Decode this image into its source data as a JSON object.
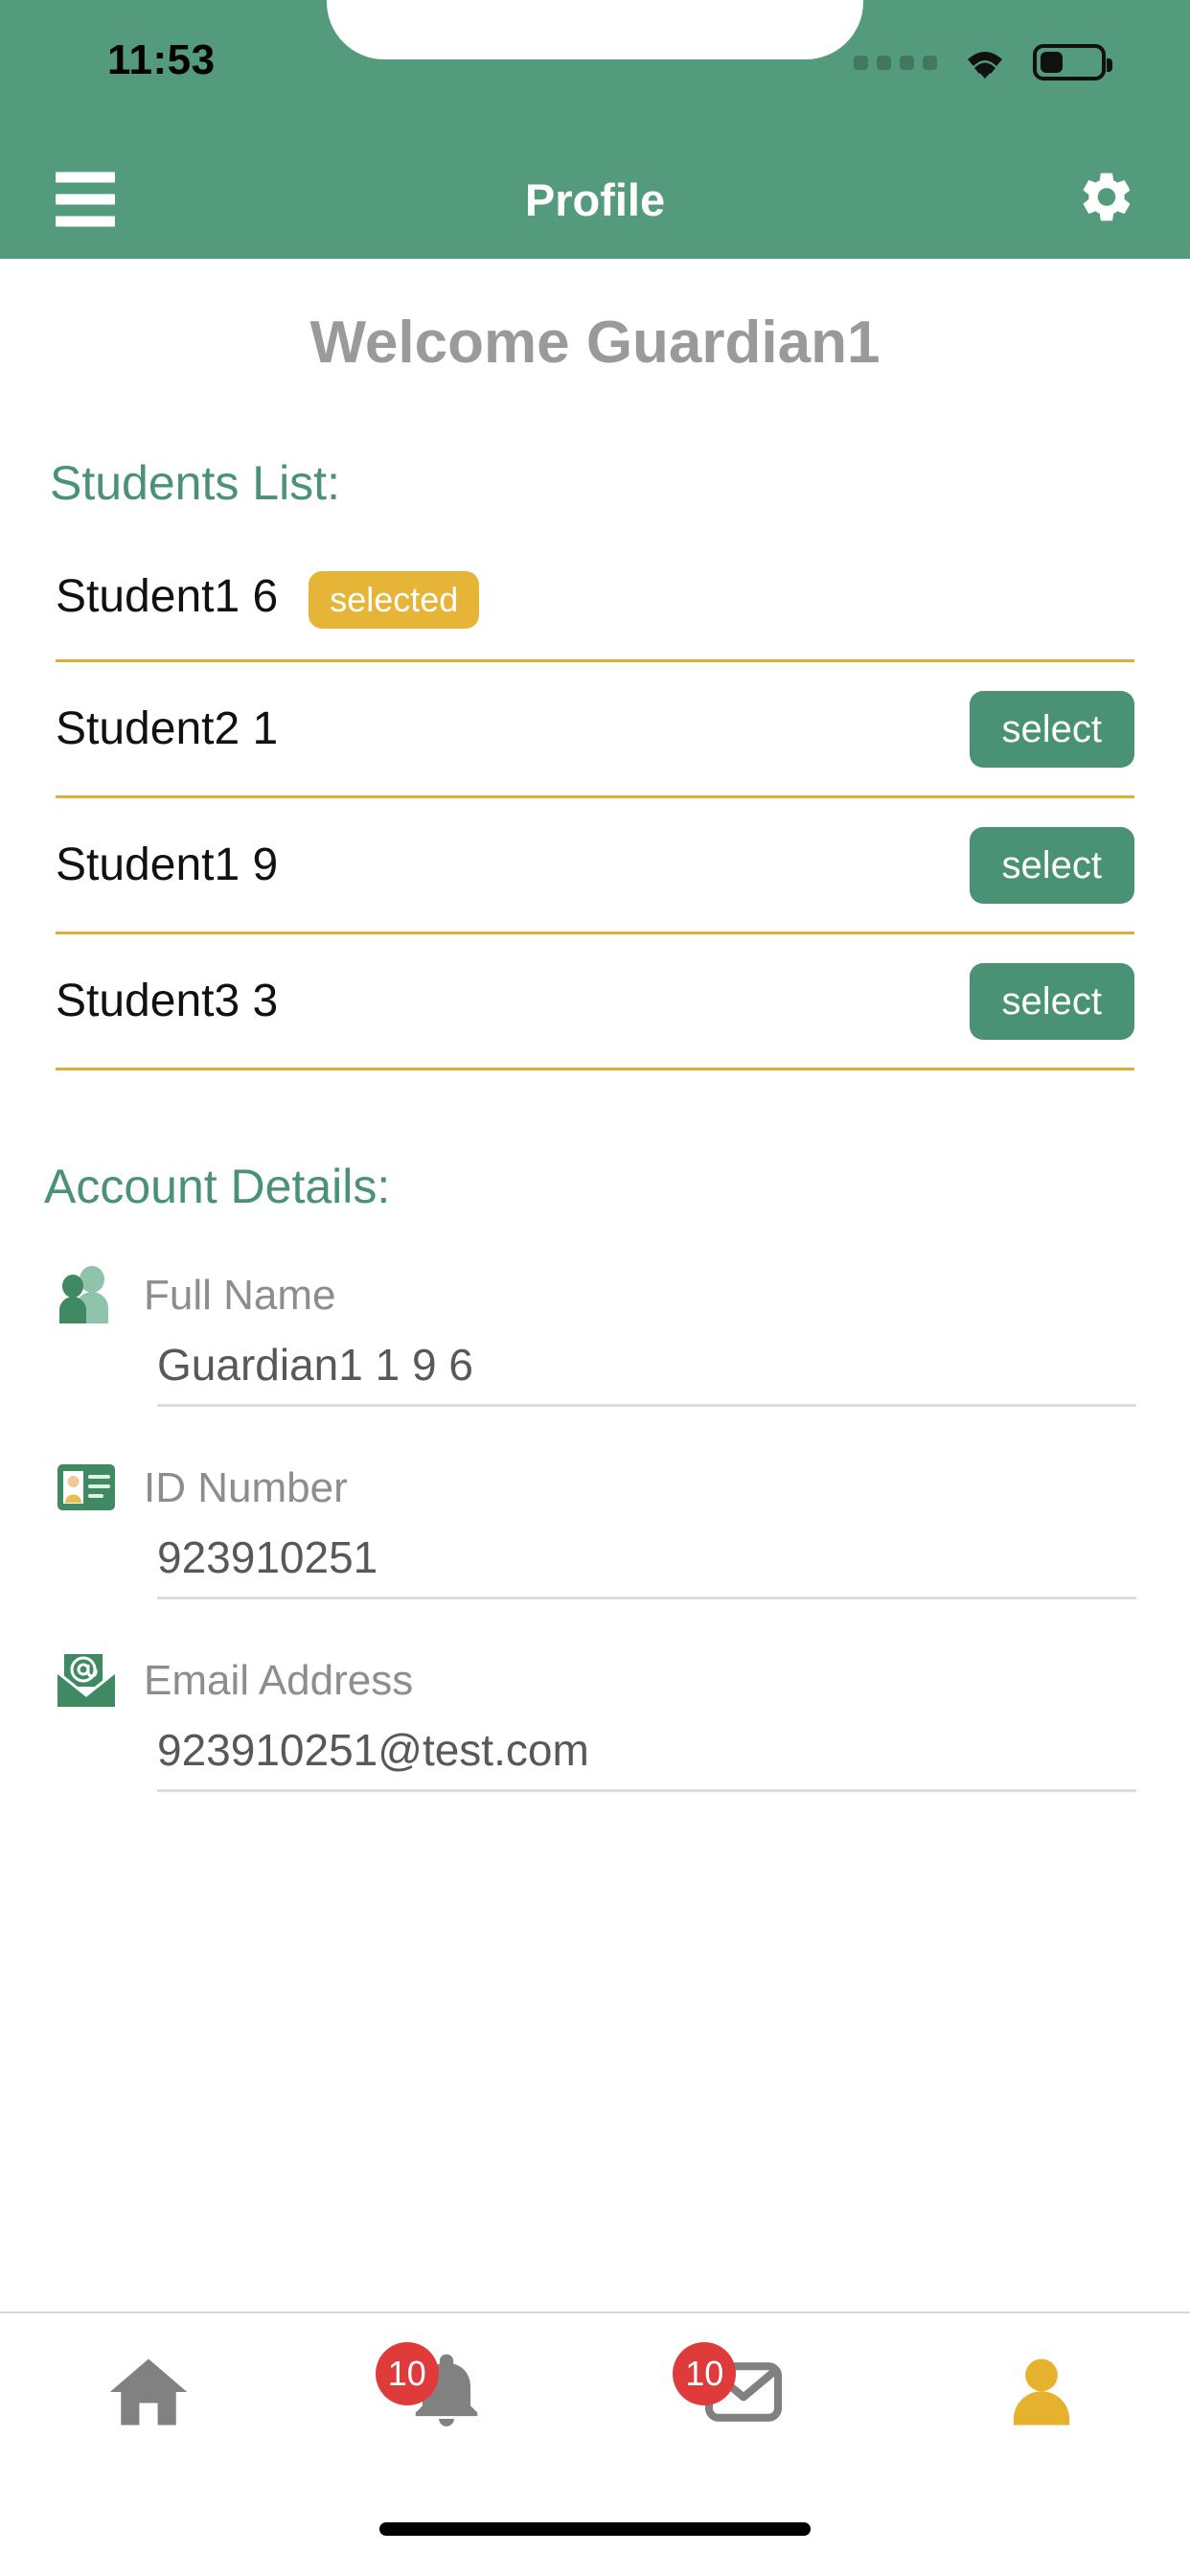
{
  "status_bar": {
    "time": "11:53",
    "signal_icon": "signal-dots-icon",
    "wifi_icon": "wifi-icon",
    "battery_icon": "battery-icon",
    "battery_level_pct": 34
  },
  "header": {
    "menu_icon": "hamburger-menu-icon",
    "title": "Profile",
    "settings_icon": "gear-icon",
    "background_color": "#539b7c"
  },
  "page": {
    "welcome_text": "Welcome Guardian1"
  },
  "students_section": {
    "title": "Students List:",
    "rows": [
      {
        "name": "Student1 6",
        "state_label": "selected",
        "state": "selected"
      },
      {
        "name": "Student2 1",
        "action_label": "select",
        "state": "unselected"
      },
      {
        "name": "Student1 9",
        "action_label": "select",
        "state": "unselected"
      },
      {
        "name": "Student3 3",
        "action_label": "select",
        "state": "unselected"
      }
    ]
  },
  "account_section": {
    "title": "Account Details:",
    "fields": [
      {
        "icon": "users-icon",
        "label": "Full Name",
        "value": "Guardian1 1 9 6"
      },
      {
        "icon": "id-card-icon",
        "label": "ID Number",
        "value": "923910251"
      },
      {
        "icon": "email-envelope-icon",
        "label": "Email Address",
        "value": "923910251@test.com"
      }
    ]
  },
  "tab_bar": {
    "tabs": [
      {
        "icon": "home-icon",
        "badge": null,
        "active": false
      },
      {
        "icon": "bell-icon",
        "badge": "10",
        "active": false
      },
      {
        "icon": "mail-icon",
        "badge": "10",
        "active": false
      },
      {
        "icon": "person-icon",
        "badge": null,
        "active": true
      }
    ]
  },
  "colors": {
    "brand_green": "#539b7c",
    "accent_green": "#4a9275",
    "gold": "#e6b537",
    "divider_gold": "#dfae34",
    "badge_red": "#e03b3b",
    "muted_gray": "#9a9a9a"
  }
}
